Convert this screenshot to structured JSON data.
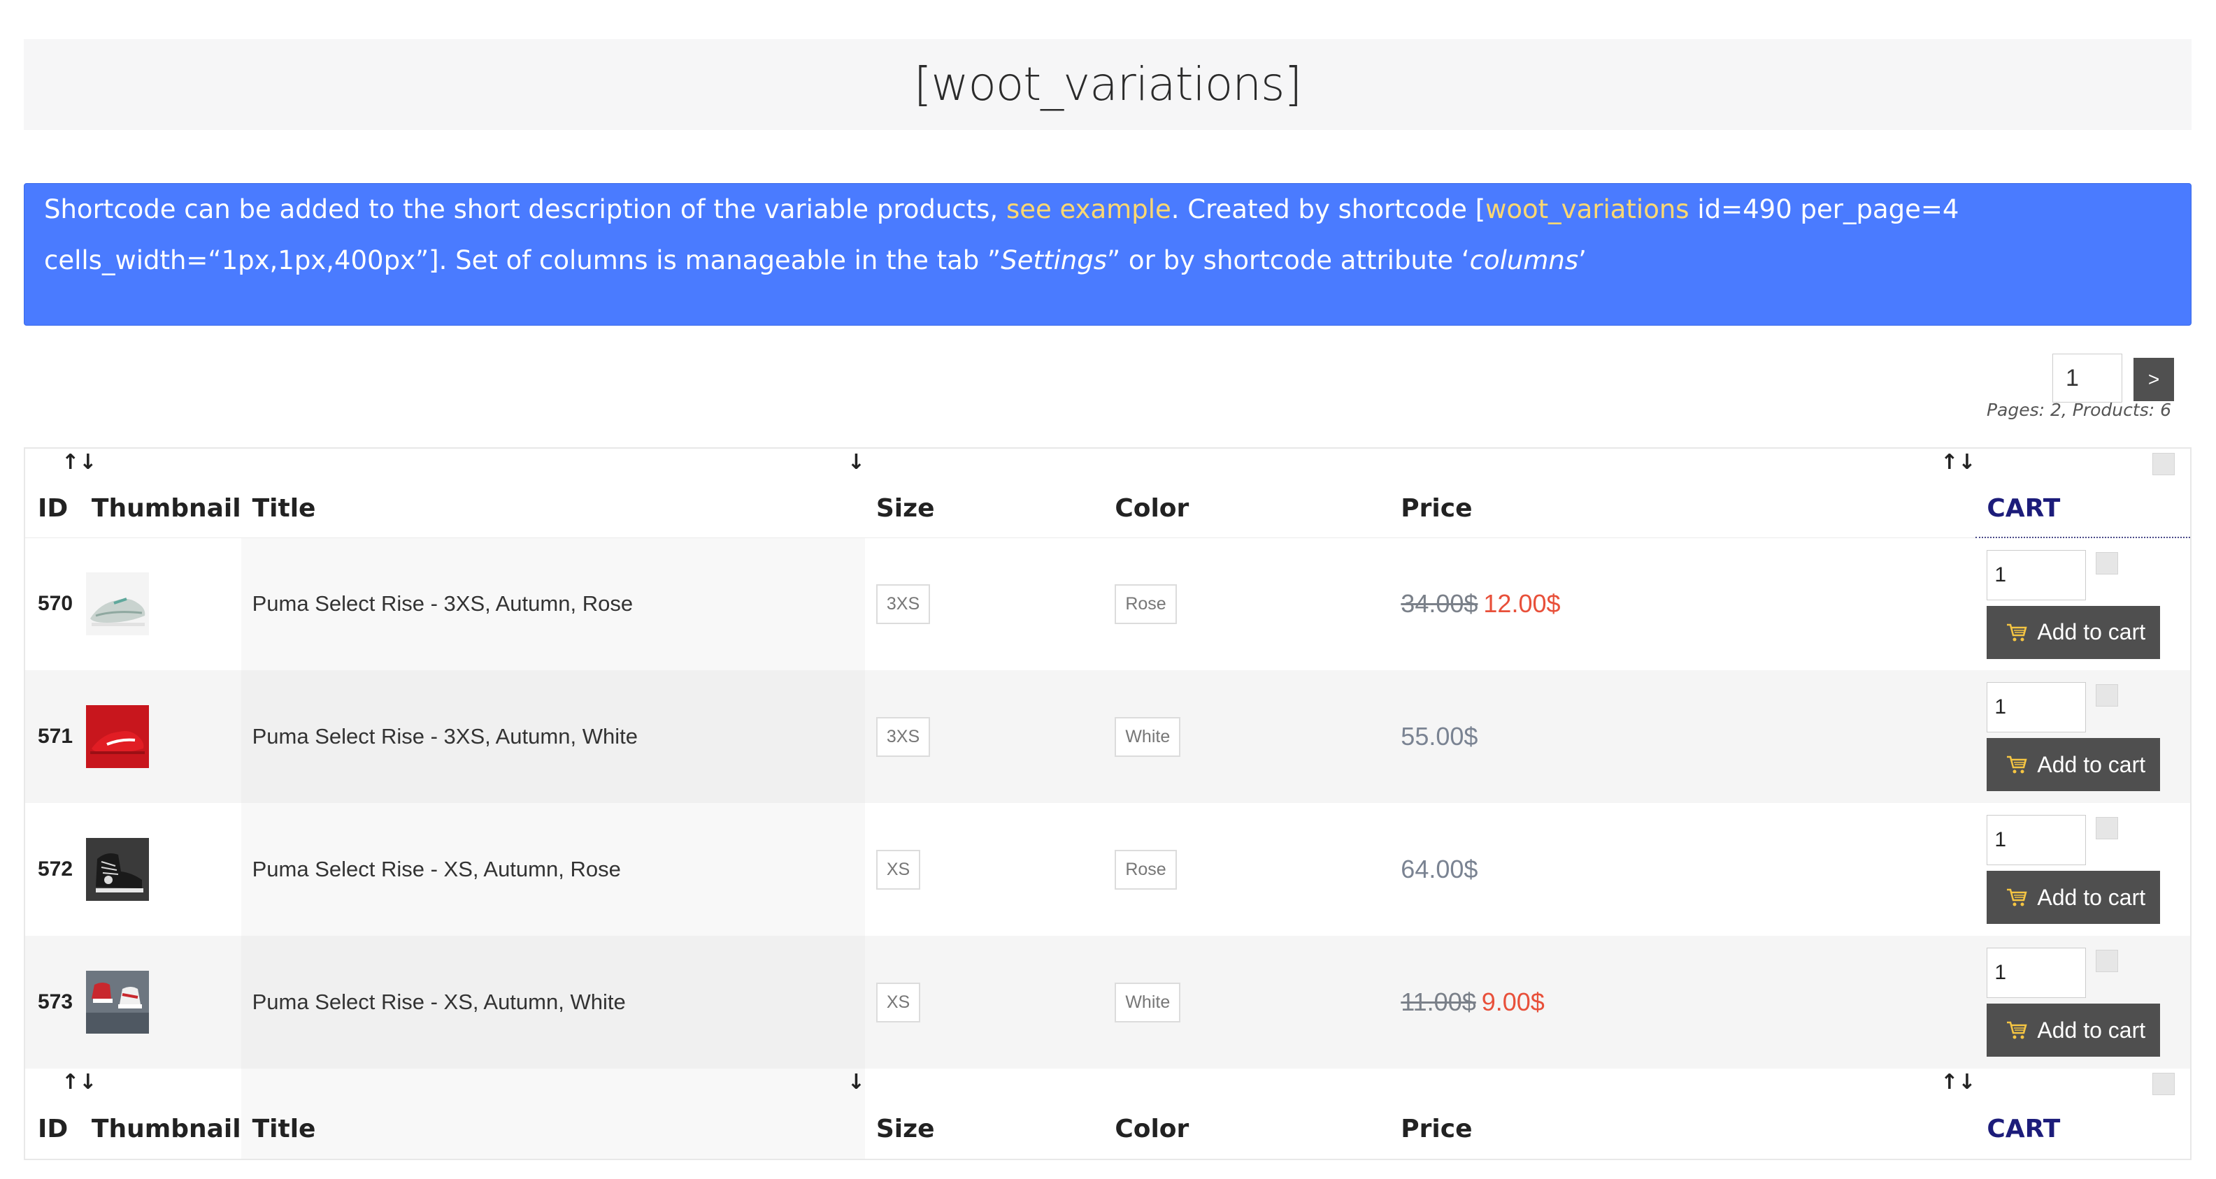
{
  "page_title": "[woot_variations]",
  "notice": {
    "t1": "Shortcode can be added to the short description of the variable products, ",
    "link1": "see example",
    "t2": ". Created by shortcode [",
    "link2": "woot_variations",
    "t3": " id=490 per_page=4 cells_width=“1px,1px,400px”]. Set of columns is manageable in the tab ”",
    "em1": "Settings",
    "t4": "” or by shortcode attribute ‘",
    "em2": "columns",
    "t5": "’"
  },
  "pager": {
    "page_value": "1",
    "next_label": ">",
    "info": "Pages: 2, Products: 6"
  },
  "columns": {
    "id": "ID",
    "thumbnail": "Thumbnail",
    "title": "Title",
    "size": "Size",
    "color": "Color",
    "price": "Price",
    "cart": "CART"
  },
  "sort_icons": {
    "id": "↑↓",
    "title": "↓",
    "price": "↑↓"
  },
  "rows": [
    {
      "id": "570",
      "thumb_icon": "shoe-gray-icon",
      "title": "Puma Select Rise - 3XS, Autumn, Rose",
      "size": "3XS",
      "color": "Rose",
      "price_old": "34.00$",
      "price_new": "12.00$",
      "price": "",
      "qty": "1",
      "button": "Add to cart"
    },
    {
      "id": "571",
      "thumb_icon": "shoe-red-icon",
      "title": "Puma Select Rise - 3XS, Autumn, White",
      "size": "3XS",
      "color": "White",
      "price_old": "",
      "price_new": "",
      "price": "55.00$",
      "qty": "1",
      "button": "Add to cart"
    },
    {
      "id": "572",
      "thumb_icon": "shoe-black-icon",
      "title": "Puma Select Rise - XS, Autumn, Rose",
      "size": "XS",
      "color": "Rose",
      "price_old": "",
      "price_new": "",
      "price": "64.00$",
      "qty": "1",
      "button": "Add to cart"
    },
    {
      "id": "573",
      "thumb_icon": "shoe-redgray-icon",
      "title": "Puma Select Rise - XS, Autumn, White",
      "size": "XS",
      "color": "White",
      "price_old": "11.00$",
      "price_new": "9.00$",
      "price": "",
      "qty": "1",
      "button": "Add to cart"
    }
  ],
  "colors": {
    "accent": "#4a7bff",
    "link": "#ffd870",
    "sale": "#e8503a",
    "button": "#4f4f4f",
    "cart_head": "#1c1c7a"
  }
}
